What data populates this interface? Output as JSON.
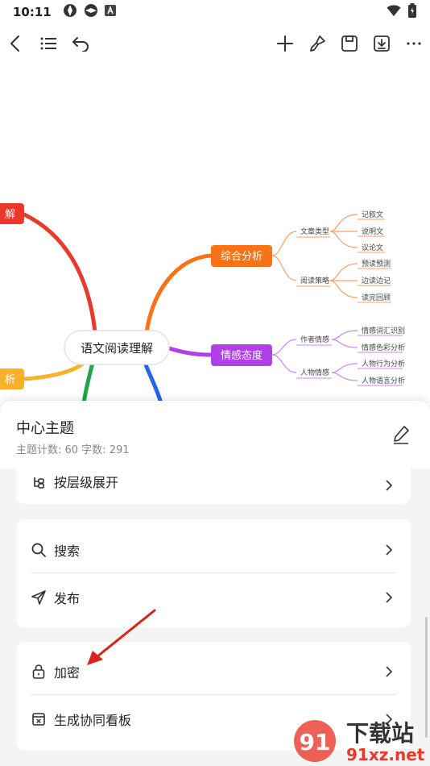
{
  "status": {
    "time": "10:11"
  },
  "mindmap": {
    "center": "语文阅读理解",
    "left_partial_1": "解",
    "left_partial_2": "析",
    "branch_1": {
      "label": "综合分析",
      "color": "#f97316",
      "children": [
        {
          "label": "文章类型",
          "leaves": [
            "记叙文",
            "说明文",
            "议论文"
          ]
        },
        {
          "label": "阅读策略",
          "leaves": [
            "预读预测",
            "边读边记",
            "读完回顾"
          ]
        }
      ]
    },
    "branch_2": {
      "label": "情感态度",
      "color": "#b13fe8",
      "children": [
        {
          "label": "作者情感",
          "leaves": [
            "情感词汇识别",
            "情感色彩分析"
          ]
        },
        {
          "label": "人物情感",
          "leaves": [
            "人物行为分析",
            "人物语言分析"
          ]
        }
      ]
    }
  },
  "sheet": {
    "title": "中心主题",
    "stats": "主题计数: 60  字数: 291",
    "items": {
      "expand": "按层级展开",
      "search": "搜索",
      "publish": "发布",
      "encrypt": "加密",
      "board": "生成协同看板"
    }
  },
  "watermark": {
    "logo": "91",
    "title": "下载站",
    "url": "91xz.net"
  },
  "colors": {
    "red": "#e8392c",
    "orange": "#f97316",
    "purple": "#b13fe8",
    "yellow": "#f6b22b",
    "green": "#22a447",
    "blue": "#2463eb"
  }
}
